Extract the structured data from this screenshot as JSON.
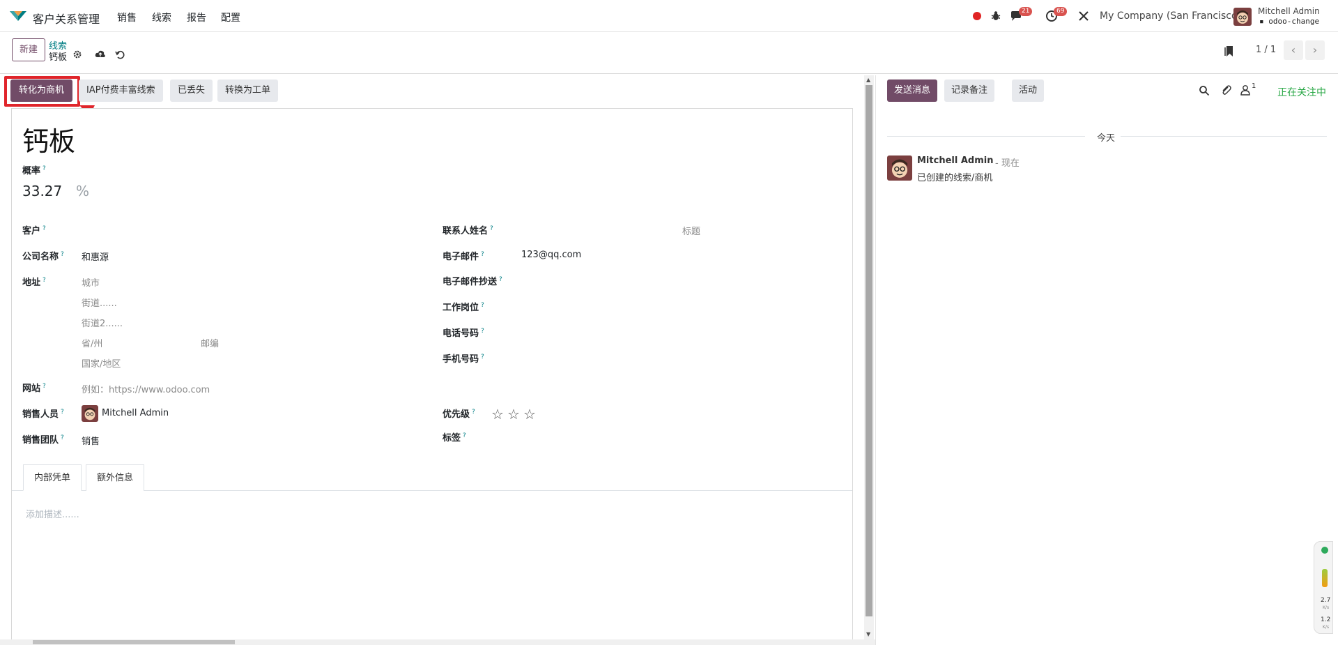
{
  "app": {
    "title": "客户关系管理",
    "menu": [
      "销售",
      "线索",
      "报告",
      "配置"
    ],
    "badges": {
      "messages": "21",
      "activities": "69"
    },
    "company": "My Company (San Francisco)",
    "user_name": "Mitchell Admin",
    "user_db": "odoo-change"
  },
  "control_panel": {
    "new_label": "新建",
    "breadcrumb_parent": "线索",
    "breadcrumb_current": "钙板",
    "pager": "1 / 1"
  },
  "statusbar": {
    "buttons": [
      "转化为商机",
      "IAP付费丰富线索",
      "已丢失",
      "转换为工单"
    ]
  },
  "form": {
    "title": "钙板",
    "probability_label": "概率",
    "probability_value": "33.27",
    "probability_unit": "%",
    "left_fields": {
      "customer_label": "客户",
      "company_label": "公司名称",
      "company_value": "和惠源",
      "address_label": "地址",
      "address_city": "城市",
      "address_street": "街道......",
      "address_street2": "街道2......",
      "address_state": "省/州",
      "address_zip": "邮编",
      "address_country": "国家/地区",
      "website_label": "网站",
      "website_placeholder": "例如：https://www.odoo.com",
      "salesperson_label": "销售人员",
      "salesperson_value": "Mitchell Admin",
      "team_label": "销售团队",
      "team_value": "销售"
    },
    "right_fields": {
      "contact_name_label": "联系人姓名",
      "contact_title_placeholder": "标题",
      "email_label": "电子邮件",
      "email_value": "123@qq.com",
      "email_cc_label": "电子邮件抄送",
      "job_label": "工作岗位",
      "phone_label": "电话号码",
      "mobile_label": "手机号码",
      "priority_label": "优先级",
      "priority_stars": 0,
      "priority_max": 3,
      "tags_label": "标签"
    },
    "tabs": [
      "内部凭单",
      "额外信息"
    ],
    "description_placeholder": "添加描述......"
  },
  "chatter": {
    "buttons": [
      "发送消息",
      "记录备注",
      "活动"
    ],
    "follower_count": "1",
    "following_label": "正在关注中",
    "day_label": "今天",
    "message": {
      "author": "Mitchell Admin",
      "time": "- 现在",
      "body": "已创建的线索/商机"
    }
  },
  "speed_widget": {
    "up": "2.7",
    "down": "1.2",
    "unit": "K/s"
  },
  "colors": {
    "brand": "#714B67",
    "highlight": "#e0252b",
    "link": "#017e84",
    "following": "#28a745"
  }
}
